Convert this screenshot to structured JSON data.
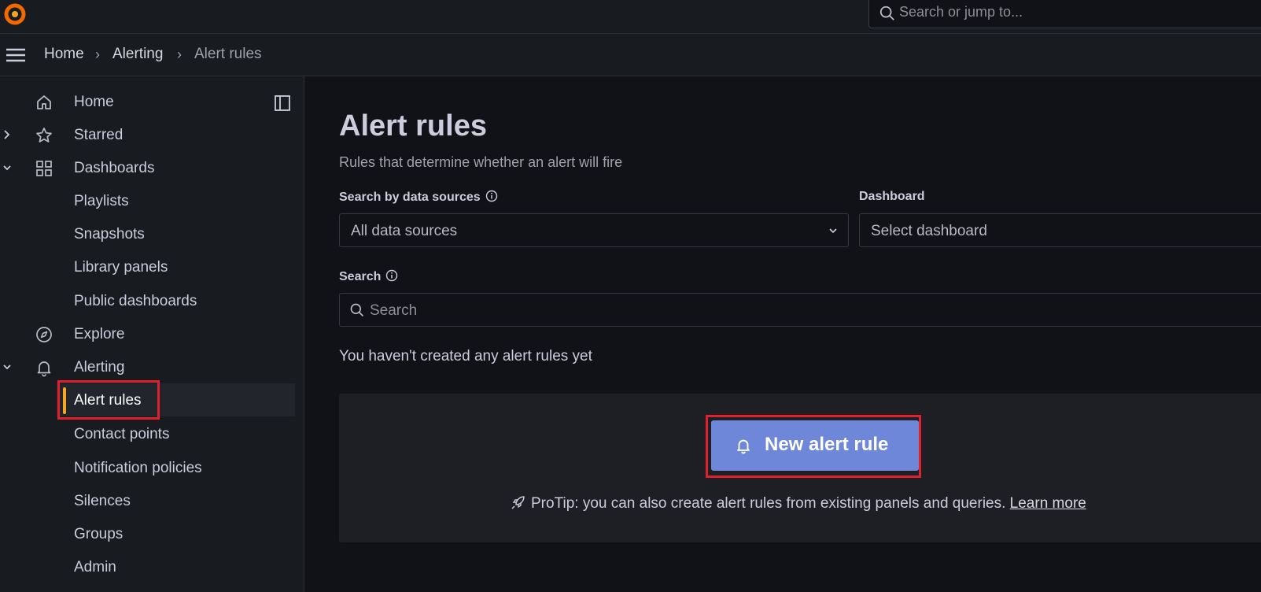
{
  "topbar": {
    "logo_icon": "grafana-logo-icon",
    "search_placeholder": "Search or jump to..."
  },
  "breadcrumb": [
    "Home",
    "Alerting",
    "Alert rules"
  ],
  "sidebar": {
    "items": [
      {
        "label": "Home",
        "icon": "home-icon"
      },
      {
        "label": "Starred",
        "icon": "star-icon",
        "expander": "collapsed"
      },
      {
        "label": "Dashboards",
        "icon": "apps-grid-icon",
        "expander": "expanded"
      },
      {
        "label": "Playlists"
      },
      {
        "label": "Snapshots"
      },
      {
        "label": "Library panels"
      },
      {
        "label": "Public dashboards"
      },
      {
        "label": "Explore",
        "icon": "compass-icon"
      },
      {
        "label": "Alerting",
        "icon": "bell-icon",
        "expander": "expanded"
      },
      {
        "label": "Alert rules",
        "active": true
      },
      {
        "label": "Contact points"
      },
      {
        "label": "Notification policies"
      },
      {
        "label": "Silences"
      },
      {
        "label": "Groups"
      },
      {
        "label": "Admin"
      }
    ]
  },
  "main": {
    "title": "Alert rules",
    "subtitle": "Rules that determine whether an alert will fire",
    "datasource_label": "Search by data sources",
    "datasource_value": "All data sources",
    "dashboard_label": "Dashboard",
    "dashboard_value": "Select dashboard",
    "search_label": "Search",
    "search_placeholder": "Search",
    "empty_message": "You haven't created any alert rules yet",
    "new_rule_button": "New alert rule",
    "protip_text": "ProTip: you can also create alert rules from existing panels and queries.",
    "learn_more": "Learn more"
  },
  "colors": {
    "primary_button": "#6e87d8",
    "active_indicator": "#f5a623",
    "highlight_box": "#e0202a"
  }
}
